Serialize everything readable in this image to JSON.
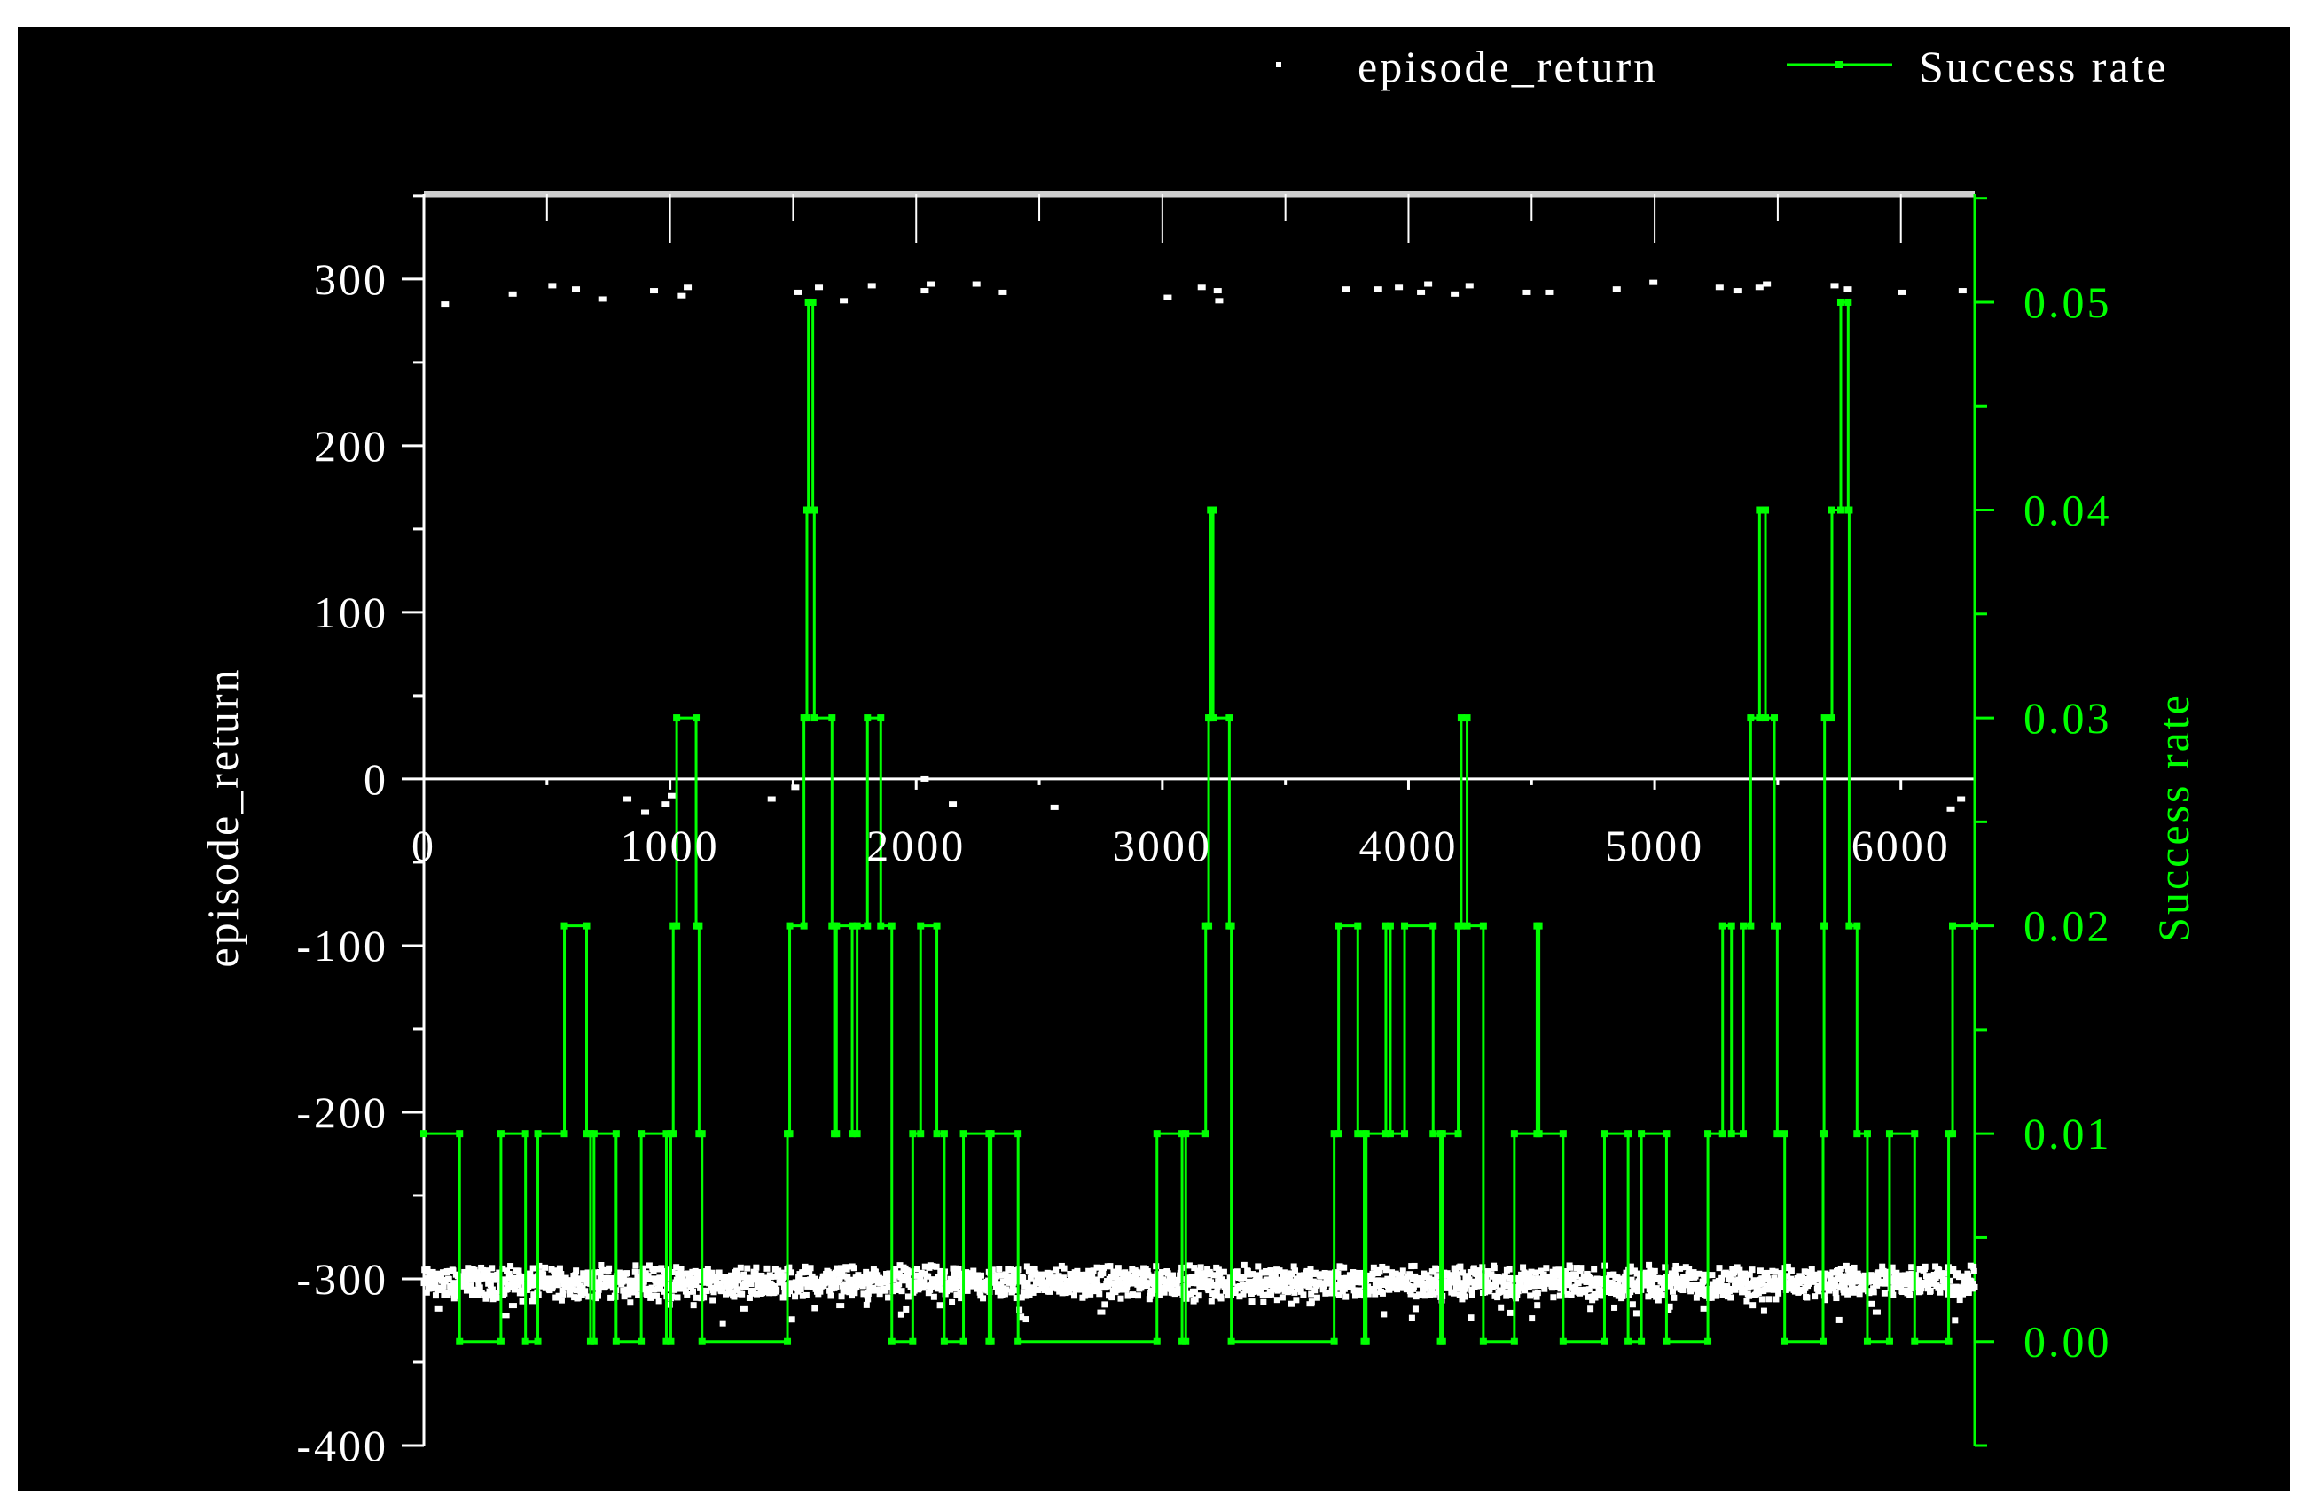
{
  "chart_data": {
    "type": "scatter+line",
    "title": "",
    "xlabel": "",
    "ylabel": "episode_return",
    "ylabel_right": "Success rate",
    "xlim": [
      0,
      6300
    ],
    "ylim": [
      -400,
      351
    ],
    "ylim_right": [
      -0.005,
      0.0552
    ],
    "x_ticks": [
      "0",
      "1000",
      "2000",
      "3000",
      "4000",
      "5000",
      "6000"
    ],
    "y_ticks": [
      "300",
      "200",
      "100",
      "0",
      "-100",
      "-200",
      "-300",
      "-400"
    ],
    "y_ticks_right": [
      "0.05",
      "0.04",
      "0.03",
      "0.02",
      "0.01",
      "0.00"
    ],
    "legend": {
      "placement": "top-right",
      "entries": [
        "episode_return",
        "Success rate"
      ]
    },
    "colors": {
      "background": "#000000",
      "axis": "#ffffff",
      "points": "#ffffff",
      "success": "#00ff00"
    },
    "series": [
      {
        "name": "episode_return",
        "kind": "scatter",
        "band": {
          "x_start": 0,
          "x_end": 6300,
          "count": 2600,
          "center": -302,
          "spread": 11,
          "low_tail": -322
        },
        "outliers": [
          [
            84,
            285
          ],
          [
            359,
            291
          ],
          [
            520,
            296
          ],
          [
            616,
            294
          ],
          [
            723,
            288
          ],
          [
            933,
            293
          ],
          [
            1046,
            290
          ],
          [
            1070,
            295
          ],
          [
            1519,
            292
          ],
          [
            1603,
            295
          ],
          [
            1704,
            287
          ],
          [
            1818,
            296
          ],
          [
            2033,
            293
          ],
          [
            2057,
            297
          ],
          [
            2243,
            297
          ],
          [
            2350,
            292
          ],
          [
            3020,
            289
          ],
          [
            3158,
            295
          ],
          [
            3223,
            293
          ],
          [
            3229,
            287
          ],
          [
            3744,
            294
          ],
          [
            3875,
            294
          ],
          [
            3959,
            295
          ],
          [
            4049,
            292
          ],
          [
            4078,
            297
          ],
          [
            4186,
            291
          ],
          [
            4246,
            296
          ],
          [
            4479,
            292
          ],
          [
            4569,
            292
          ],
          [
            4844,
            294
          ],
          [
            4993,
            298
          ],
          [
            5262,
            295
          ],
          [
            5334,
            293
          ],
          [
            5424,
            295
          ],
          [
            5454,
            297
          ],
          [
            5729,
            296
          ],
          [
            5783,
            294
          ],
          [
            6004,
            292
          ],
          [
            6249,
            293
          ],
          [
            825,
            -12
          ],
          [
            897,
            -20
          ],
          [
            981,
            -15
          ],
          [
            1005,
            -10
          ],
          [
            1411,
            -12
          ],
          [
            1507,
            -5
          ],
          [
            2033,
            0
          ],
          [
            2147,
            -15
          ],
          [
            2560,
            -17
          ],
          [
            6201,
            -18
          ],
          [
            6243,
            -12
          ],
          [
            60,
            -318
          ],
          [
            330,
            -322
          ],
          [
            360,
            -316
          ],
          [
            1300,
            -318
          ],
          [
            1690,
            -316
          ],
          [
            2750,
            -320
          ],
          [
            3600,
            -315
          ],
          [
            5200,
            -318
          ],
          [
            5900,
            -320
          ]
        ]
      },
      {
        "name": "Success rate",
        "kind": "step",
        "points": [
          [
            0,
            0.01
          ],
          [
            145,
            0
          ],
          [
            313,
            0.01
          ],
          [
            413,
            0
          ],
          [
            463,
            0.01
          ],
          [
            571,
            0.02
          ],
          [
            661,
            0.01
          ],
          [
            677,
            0
          ],
          [
            691,
            0.01
          ],
          [
            781,
            0
          ],
          [
            883,
            0.01
          ],
          [
            985,
            0
          ],
          [
            1003,
            0.01
          ],
          [
            1013,
            0.02
          ],
          [
            1027,
            0.03
          ],
          [
            1106,
            0.02
          ],
          [
            1118,
            0.01
          ],
          [
            1130,
            0
          ],
          [
            1477,
            0.01
          ],
          [
            1486,
            0.02
          ],
          [
            1544,
            0.03
          ],
          [
            1556,
            0.04
          ],
          [
            1562,
            0.05
          ],
          [
            1580,
            0.04
          ],
          [
            1586,
            0.03
          ],
          [
            1658,
            0.02
          ],
          [
            1668,
            0.01
          ],
          [
            1676,
            0.02
          ],
          [
            1740,
            0.01
          ],
          [
            1760,
            0.02
          ],
          [
            1802,
            0.03
          ],
          [
            1856,
            0.02
          ],
          [
            1901,
            0
          ],
          [
            1986,
            0.01
          ],
          [
            2018,
            0.02
          ],
          [
            2084,
            0.01
          ],
          [
            2114,
            0
          ],
          [
            2192,
            0.01
          ],
          [
            2296,
            0
          ],
          [
            2304,
            0.01
          ],
          [
            2414,
            0
          ],
          [
            2978,
            0.01
          ],
          [
            3080,
            0
          ],
          [
            3095,
            0.01
          ],
          [
            3176,
            0.02
          ],
          [
            3188,
            0.03
          ],
          [
            3196,
            0.04
          ],
          [
            3206,
            0.03
          ],
          [
            3272,
            0.02
          ],
          [
            3280,
            0
          ],
          [
            3698,
            0.01
          ],
          [
            3716,
            0.02
          ],
          [
            3794,
            0.01
          ],
          [
            3820,
            0
          ],
          [
            3828,
            0.01
          ],
          [
            3908,
            0.02
          ],
          [
            3926,
            0.01
          ],
          [
            3984,
            0.02
          ],
          [
            4100,
            0.01
          ],
          [
            4130,
            0
          ],
          [
            4138,
            0.01
          ],
          [
            4202,
            0.02
          ],
          [
            4214,
            0.03
          ],
          [
            4238,
            0.02
          ],
          [
            4304,
            0
          ],
          [
            4430,
            0.01
          ],
          [
            4522,
            0.02
          ],
          [
            4530,
            0.01
          ],
          [
            4628,
            0
          ],
          [
            4796,
            0.01
          ],
          [
            4892,
            0
          ],
          [
            4946,
            0.01
          ],
          [
            5048,
            0
          ],
          [
            5216,
            0.01
          ],
          [
            5276,
            0.02
          ],
          [
            5312,
            0.01
          ],
          [
            5360,
            0.02
          ],
          [
            5390,
            0.03
          ],
          [
            5426,
            0.04
          ],
          [
            5450,
            0.03
          ],
          [
            5486,
            0.02
          ],
          [
            5498,
            0.01
          ],
          [
            5528,
            0
          ],
          [
            5684,
            0.01
          ],
          [
            5688,
            0.02
          ],
          [
            5690,
            0.03
          ],
          [
            5720,
            0.04
          ],
          [
            5756,
            0.05
          ],
          [
            5786,
            0.04
          ],
          [
            5790,
            0.02
          ],
          [
            5822,
            0.01
          ],
          [
            5864,
            0
          ],
          [
            5954,
            0.01
          ],
          [
            6056,
            0
          ],
          [
            6194,
            0.01
          ],
          [
            6210,
            0.02
          ],
          [
            6300,
            0.02
          ]
        ]
      }
    ]
  }
}
